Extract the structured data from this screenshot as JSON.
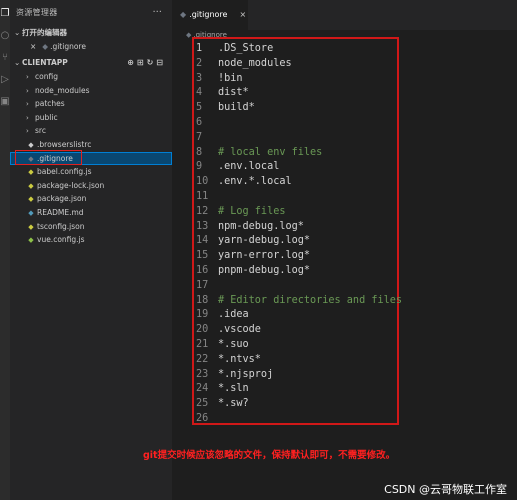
{
  "activity_icons": [
    "files-icon",
    "search-icon",
    "source-control-icon",
    "run-debug-icon",
    "extensions-icon"
  ],
  "sidebar": {
    "title": "资源管理器",
    "more": "···",
    "open_editors": {
      "header": "打开的编辑器",
      "files": [
        {
          "close": "×",
          "name": ".gitignore"
        }
      ]
    },
    "project": {
      "header": "CLIENTAPP",
      "items": [
        {
          "type": "folder",
          "name": "config"
        },
        {
          "type": "folder",
          "name": "node_modules"
        },
        {
          "type": "folder",
          "name": "patches"
        },
        {
          "type": "folder",
          "name": "public"
        },
        {
          "type": "folder",
          "name": "src"
        },
        {
          "type": "file",
          "name": ".browserslistrc",
          "icon_color": "#cccccc"
        },
        {
          "type": "file",
          "name": ".gitignore",
          "icon_color": "#6e7681",
          "selected": true
        },
        {
          "type": "file",
          "name": "babel.config.js",
          "icon_color": "#cbcb41"
        },
        {
          "type": "file",
          "name": "package-lock.json",
          "icon_color": "#cbcb41"
        },
        {
          "type": "file",
          "name": "package.json",
          "icon_color": "#cbcb41"
        },
        {
          "type": "file",
          "name": "README.md",
          "icon_color": "#519aba"
        },
        {
          "type": "file",
          "name": "tsconfig.json",
          "icon_color": "#cbcb41"
        },
        {
          "type": "file",
          "name": "vue.config.js",
          "icon_color": "#8dc149"
        }
      ]
    }
  },
  "editor": {
    "tab": {
      "label": ".gitignore",
      "close": "×"
    },
    "breadcrumb": ".gitignore",
    "lines": [
      {
        "n": "1",
        "text": ".DS_Store"
      },
      {
        "n": "2",
        "text": "node_modules"
      },
      {
        "n": "3",
        "text": "!bin"
      },
      {
        "n": "4",
        "text": "dist*"
      },
      {
        "n": "5",
        "text": "build*"
      },
      {
        "n": "6",
        "text": ""
      },
      {
        "n": "7",
        "text": ""
      },
      {
        "n": "8",
        "text": "# local env files",
        "comment": true
      },
      {
        "n": "9",
        "text": ".env.local"
      },
      {
        "n": "10",
        "text": ".env.*.local"
      },
      {
        "n": "11",
        "text": ""
      },
      {
        "n": "12",
        "text": "# Log files",
        "comment": true
      },
      {
        "n": "13",
        "text": "npm-debug.log*"
      },
      {
        "n": "14",
        "text": "yarn-debug.log*"
      },
      {
        "n": "15",
        "text": "yarn-error.log*"
      },
      {
        "n": "16",
        "text": "pnpm-debug.log*"
      },
      {
        "n": "17",
        "text": ""
      },
      {
        "n": "18",
        "text": "# Editor directories and files",
        "comment": true
      },
      {
        "n": "19",
        "text": ".idea"
      },
      {
        "n": "20",
        "text": ".vscode"
      },
      {
        "n": "21",
        "text": "*.suo"
      },
      {
        "n": "22",
        "text": "*.ntvs*"
      },
      {
        "n": "23",
        "text": "*.njsproj"
      },
      {
        "n": "24",
        "text": "*.sln"
      },
      {
        "n": "25",
        "text": "*.sw?"
      },
      {
        "n": "26",
        "text": ""
      }
    ]
  },
  "annotation": "git提交时候应该忽略的文件，保持默认即可，不需要修改。",
  "watermark": "CSDN @云哥物联工作室",
  "colors": {
    "comment": "#6a9955",
    "highlight_box": "#d01818",
    "annotation": "#ff2020",
    "selection": "#094771"
  }
}
